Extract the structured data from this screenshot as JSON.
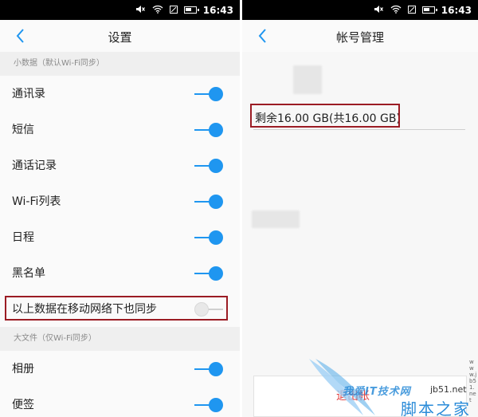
{
  "status": {
    "time": "16:43"
  },
  "left": {
    "title": "设置",
    "sections": [
      {
        "header": "小数据（默认Wi-Fi同步）",
        "rows": [
          {
            "label": "通讯录",
            "on": true
          },
          {
            "label": "短信",
            "on": true
          },
          {
            "label": "通话记录",
            "on": true
          },
          {
            "label": "Wi-Fi列表",
            "on": true
          },
          {
            "label": "日程",
            "on": true
          },
          {
            "label": "黑名单",
            "on": true
          },
          {
            "label": "以上数据在移动网络下也同步",
            "on": false
          }
        ]
      },
      {
        "header": "大文件（仅Wi-Fi同步）",
        "rows": [
          {
            "label": "相册",
            "on": true
          },
          {
            "label": "便签",
            "on": true
          }
        ]
      }
    ]
  },
  "right": {
    "title": "帐号管理",
    "storage": "剩余16.00 GB(共16.00 GB)",
    "logout": "退出帐"
  },
  "watermark": {
    "cn": "我爱IT技术网",
    "url": "jb51.net",
    "brand": "脚本之家",
    "vertical": "www.jb51.net"
  },
  "colors": {
    "accent": "#1f96f0",
    "highlight": "#9b1c24",
    "logout": "#e03a3a"
  }
}
